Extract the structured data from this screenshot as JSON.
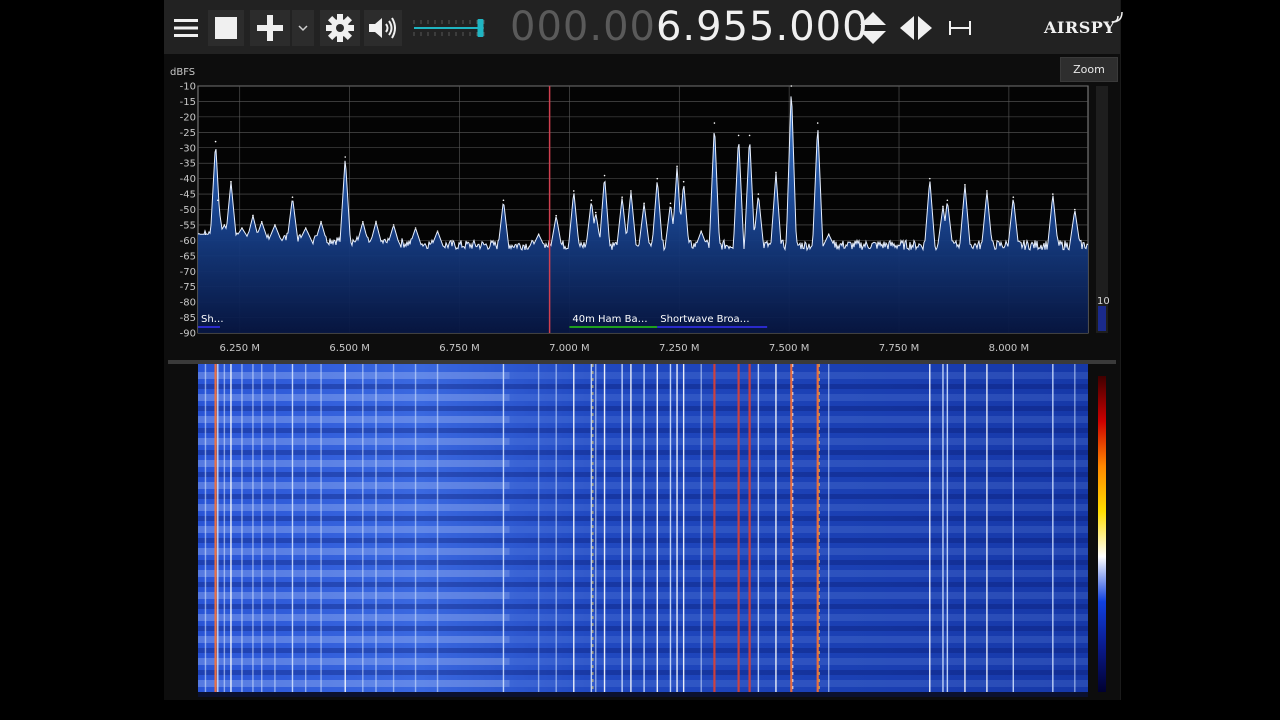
{
  "toolbar": {
    "menu_icon": "hamburger-menu-icon",
    "stop_icon": "stop-square-icon",
    "add_icon": "plus-icon",
    "dropdown_icon": "chevron-down-icon",
    "settings_icon": "gear-icon",
    "audio_icon": "speaker-icon",
    "volume_level": 0.95,
    "frequency_dim": "000.00",
    "frequency_lit": "6.955.000",
    "step_icon": "up-down-arrows-icon",
    "tune_icon": "left-right-arrows-icon",
    "bandwidth_icon": "span-bracket-icon",
    "logo_text": "AIRSPY"
  },
  "spectrum": {
    "zoom_label": "Zoom",
    "contrast_value": "10",
    "band_labels": [
      {
        "label": "Sh…",
        "color": "#2a2acc",
        "start_mhz": 6.155,
        "end_mhz": 6.205
      },
      {
        "label": "40m Ham Ba…",
        "color": "#1ea01e",
        "start_mhz": 7.0,
        "end_mhz": 7.2
      },
      {
        "label": "Shortwave Broa…",
        "color": "#2a2acc",
        "start_mhz": 7.2,
        "end_mhz": 7.45
      }
    ]
  },
  "chart_data": {
    "type": "line",
    "ylabel": "dBFS",
    "ylim": [
      -90,
      -10
    ],
    "yticks": [
      "-10",
      "-15",
      "-20",
      "-25",
      "-30",
      "-35",
      "-40",
      "-45",
      "-50",
      "-55",
      "-60",
      "-65",
      "-70",
      "-75",
      "-80",
      "-85",
      "-90"
    ],
    "xlim_mhz": [
      6.155,
      8.18
    ],
    "xticks": [
      {
        "label": "6.250 M",
        "mhz": 6.25
      },
      {
        "label": "6.500 M",
        "mhz": 6.5
      },
      {
        "label": "6.750 M",
        "mhz": 6.75
      },
      {
        "label": "7.000 M",
        "mhz": 7.0
      },
      {
        "label": "7.250 M",
        "mhz": 7.25
      },
      {
        "label": "7.500 M",
        "mhz": 7.5
      },
      {
        "label": "7.750 M",
        "mhz": 7.75
      },
      {
        "label": "8.000 M",
        "mhz": 8.0
      }
    ],
    "tuned_mhz": 6.955,
    "peaks": [
      {
        "mhz": 6.172,
        "db": -58
      },
      {
        "mhz": 6.195,
        "db": -28
      },
      {
        "mhz": 6.2,
        "db": -47
      },
      {
        "mhz": 6.215,
        "db": -55
      },
      {
        "mhz": 6.23,
        "db": -41
      },
      {
        "mhz": 6.255,
        "db": -56
      },
      {
        "mhz": 6.28,
        "db": -52
      },
      {
        "mhz": 6.3,
        "db": -54
      },
      {
        "mhz": 6.33,
        "db": -55
      },
      {
        "mhz": 6.37,
        "db": -46
      },
      {
        "mhz": 6.4,
        "db": -56
      },
      {
        "mhz": 6.435,
        "db": -54
      },
      {
        "mhz": 6.49,
        "db": -33
      },
      {
        "mhz": 6.53,
        "db": -54
      },
      {
        "mhz": 6.56,
        "db": -54
      },
      {
        "mhz": 6.6,
        "db": -55
      },
      {
        "mhz": 6.65,
        "db": -56
      },
      {
        "mhz": 6.7,
        "db": -57
      },
      {
        "mhz": 6.85,
        "db": -47
      },
      {
        "mhz": 6.93,
        "db": -58
      },
      {
        "mhz": 6.97,
        "db": -52
      },
      {
        "mhz": 7.01,
        "db": -44
      },
      {
        "mhz": 7.05,
        "db": -47
      },
      {
        "mhz": 7.06,
        "db": -51
      },
      {
        "mhz": 7.08,
        "db": -39
      },
      {
        "mhz": 7.12,
        "db": -46
      },
      {
        "mhz": 7.14,
        "db": -44
      },
      {
        "mhz": 7.17,
        "db": -48
      },
      {
        "mhz": 7.2,
        "db": -40
      },
      {
        "mhz": 7.23,
        "db": -48
      },
      {
        "mhz": 7.245,
        "db": -36
      },
      {
        "mhz": 7.26,
        "db": -41
      },
      {
        "mhz": 7.3,
        "db": -57
      },
      {
        "mhz": 7.33,
        "db": -22
      },
      {
        "mhz": 7.385,
        "db": -26
      },
      {
        "mhz": 7.41,
        "db": -26
      },
      {
        "mhz": 7.43,
        "db": -45
      },
      {
        "mhz": 7.47,
        "db": -38
      },
      {
        "mhz": 7.505,
        "db": -10
      },
      {
        "mhz": 7.565,
        "db": -22
      },
      {
        "mhz": 7.59,
        "db": -58
      },
      {
        "mhz": 7.82,
        "db": -40
      },
      {
        "mhz": 7.85,
        "db": -49
      },
      {
        "mhz": 7.86,
        "db": -47
      },
      {
        "mhz": 7.9,
        "db": -42
      },
      {
        "mhz": 7.95,
        "db": -44
      },
      {
        "mhz": 8.01,
        "db": -46
      },
      {
        "mhz": 8.1,
        "db": -45
      },
      {
        "mhz": 8.15,
        "db": -50
      }
    ]
  },
  "waterfall": {
    "colormap": [
      "#000030",
      "#0a1a8c",
      "#1040e0",
      "#ffffff",
      "#ffdd00",
      "#ff8800",
      "#cc0000",
      "#400000"
    ]
  }
}
